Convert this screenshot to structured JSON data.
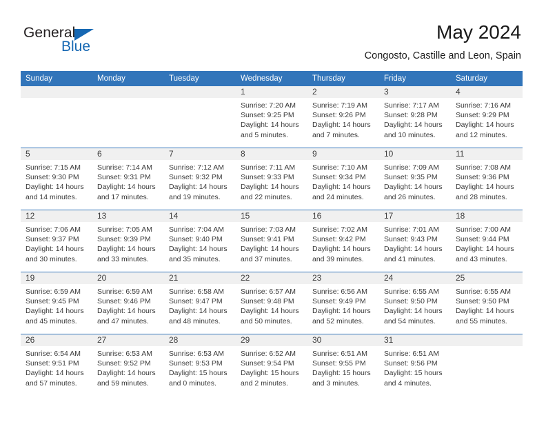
{
  "brand": {
    "name_part1": "General",
    "name_part2": "Blue",
    "accent_color": "#1668b3"
  },
  "header": {
    "month_title": "May 2024",
    "location": "Congosto, Castille and Leon, Spain"
  },
  "calendar": {
    "header_bg": "#3275ba",
    "daynum_bg": "#f0f0f0",
    "weekday_headers": [
      "Sunday",
      "Monday",
      "Tuesday",
      "Wednesday",
      "Thursday",
      "Friday",
      "Saturday"
    ],
    "weeks": [
      [
        {
          "day": "",
          "sunrise": "",
          "sunset": "",
          "daylight_line1": "",
          "daylight_line2": "",
          "empty": true
        },
        {
          "day": "",
          "sunrise": "",
          "sunset": "",
          "daylight_line1": "",
          "daylight_line2": "",
          "empty": true
        },
        {
          "day": "",
          "sunrise": "",
          "sunset": "",
          "daylight_line1": "",
          "daylight_line2": "",
          "empty": true
        },
        {
          "day": "1",
          "sunrise": "Sunrise: 7:20 AM",
          "sunset": "Sunset: 9:25 PM",
          "daylight_line1": "Daylight: 14 hours",
          "daylight_line2": "and 5 minutes.",
          "empty": false
        },
        {
          "day": "2",
          "sunrise": "Sunrise: 7:19 AM",
          "sunset": "Sunset: 9:26 PM",
          "daylight_line1": "Daylight: 14 hours",
          "daylight_line2": "and 7 minutes.",
          "empty": false
        },
        {
          "day": "3",
          "sunrise": "Sunrise: 7:17 AM",
          "sunset": "Sunset: 9:28 PM",
          "daylight_line1": "Daylight: 14 hours",
          "daylight_line2": "and 10 minutes.",
          "empty": false
        },
        {
          "day": "4",
          "sunrise": "Sunrise: 7:16 AM",
          "sunset": "Sunset: 9:29 PM",
          "daylight_line1": "Daylight: 14 hours",
          "daylight_line2": "and 12 minutes.",
          "empty": false
        }
      ],
      [
        {
          "day": "5",
          "sunrise": "Sunrise: 7:15 AM",
          "sunset": "Sunset: 9:30 PM",
          "daylight_line1": "Daylight: 14 hours",
          "daylight_line2": "and 14 minutes.",
          "empty": false
        },
        {
          "day": "6",
          "sunrise": "Sunrise: 7:14 AM",
          "sunset": "Sunset: 9:31 PM",
          "daylight_line1": "Daylight: 14 hours",
          "daylight_line2": "and 17 minutes.",
          "empty": false
        },
        {
          "day": "7",
          "sunrise": "Sunrise: 7:12 AM",
          "sunset": "Sunset: 9:32 PM",
          "daylight_line1": "Daylight: 14 hours",
          "daylight_line2": "and 19 minutes.",
          "empty": false
        },
        {
          "day": "8",
          "sunrise": "Sunrise: 7:11 AM",
          "sunset": "Sunset: 9:33 PM",
          "daylight_line1": "Daylight: 14 hours",
          "daylight_line2": "and 22 minutes.",
          "empty": false
        },
        {
          "day": "9",
          "sunrise": "Sunrise: 7:10 AM",
          "sunset": "Sunset: 9:34 PM",
          "daylight_line1": "Daylight: 14 hours",
          "daylight_line2": "and 24 minutes.",
          "empty": false
        },
        {
          "day": "10",
          "sunrise": "Sunrise: 7:09 AM",
          "sunset": "Sunset: 9:35 PM",
          "daylight_line1": "Daylight: 14 hours",
          "daylight_line2": "and 26 minutes.",
          "empty": false
        },
        {
          "day": "11",
          "sunrise": "Sunrise: 7:08 AM",
          "sunset": "Sunset: 9:36 PM",
          "daylight_line1": "Daylight: 14 hours",
          "daylight_line2": "and 28 minutes.",
          "empty": false
        }
      ],
      [
        {
          "day": "12",
          "sunrise": "Sunrise: 7:06 AM",
          "sunset": "Sunset: 9:37 PM",
          "daylight_line1": "Daylight: 14 hours",
          "daylight_line2": "and 30 minutes.",
          "empty": false
        },
        {
          "day": "13",
          "sunrise": "Sunrise: 7:05 AM",
          "sunset": "Sunset: 9:39 PM",
          "daylight_line1": "Daylight: 14 hours",
          "daylight_line2": "and 33 minutes.",
          "empty": false
        },
        {
          "day": "14",
          "sunrise": "Sunrise: 7:04 AM",
          "sunset": "Sunset: 9:40 PM",
          "daylight_line1": "Daylight: 14 hours",
          "daylight_line2": "and 35 minutes.",
          "empty": false
        },
        {
          "day": "15",
          "sunrise": "Sunrise: 7:03 AM",
          "sunset": "Sunset: 9:41 PM",
          "daylight_line1": "Daylight: 14 hours",
          "daylight_line2": "and 37 minutes.",
          "empty": false
        },
        {
          "day": "16",
          "sunrise": "Sunrise: 7:02 AM",
          "sunset": "Sunset: 9:42 PM",
          "daylight_line1": "Daylight: 14 hours",
          "daylight_line2": "and 39 minutes.",
          "empty": false
        },
        {
          "day": "17",
          "sunrise": "Sunrise: 7:01 AM",
          "sunset": "Sunset: 9:43 PM",
          "daylight_line1": "Daylight: 14 hours",
          "daylight_line2": "and 41 minutes.",
          "empty": false
        },
        {
          "day": "18",
          "sunrise": "Sunrise: 7:00 AM",
          "sunset": "Sunset: 9:44 PM",
          "daylight_line1": "Daylight: 14 hours",
          "daylight_line2": "and 43 minutes.",
          "empty": false
        }
      ],
      [
        {
          "day": "19",
          "sunrise": "Sunrise: 6:59 AM",
          "sunset": "Sunset: 9:45 PM",
          "daylight_line1": "Daylight: 14 hours",
          "daylight_line2": "and 45 minutes.",
          "empty": false
        },
        {
          "day": "20",
          "sunrise": "Sunrise: 6:59 AM",
          "sunset": "Sunset: 9:46 PM",
          "daylight_line1": "Daylight: 14 hours",
          "daylight_line2": "and 47 minutes.",
          "empty": false
        },
        {
          "day": "21",
          "sunrise": "Sunrise: 6:58 AM",
          "sunset": "Sunset: 9:47 PM",
          "daylight_line1": "Daylight: 14 hours",
          "daylight_line2": "and 48 minutes.",
          "empty": false
        },
        {
          "day": "22",
          "sunrise": "Sunrise: 6:57 AM",
          "sunset": "Sunset: 9:48 PM",
          "daylight_line1": "Daylight: 14 hours",
          "daylight_line2": "and 50 minutes.",
          "empty": false
        },
        {
          "day": "23",
          "sunrise": "Sunrise: 6:56 AM",
          "sunset": "Sunset: 9:49 PM",
          "daylight_line1": "Daylight: 14 hours",
          "daylight_line2": "and 52 minutes.",
          "empty": false
        },
        {
          "day": "24",
          "sunrise": "Sunrise: 6:55 AM",
          "sunset": "Sunset: 9:50 PM",
          "daylight_line1": "Daylight: 14 hours",
          "daylight_line2": "and 54 minutes.",
          "empty": false
        },
        {
          "day": "25",
          "sunrise": "Sunrise: 6:55 AM",
          "sunset": "Sunset: 9:50 PM",
          "daylight_line1": "Daylight: 14 hours",
          "daylight_line2": "and 55 minutes.",
          "empty": false
        }
      ],
      [
        {
          "day": "26",
          "sunrise": "Sunrise: 6:54 AM",
          "sunset": "Sunset: 9:51 PM",
          "daylight_line1": "Daylight: 14 hours",
          "daylight_line2": "and 57 minutes.",
          "empty": false
        },
        {
          "day": "27",
          "sunrise": "Sunrise: 6:53 AM",
          "sunset": "Sunset: 9:52 PM",
          "daylight_line1": "Daylight: 14 hours",
          "daylight_line2": "and 59 minutes.",
          "empty": false
        },
        {
          "day": "28",
          "sunrise": "Sunrise: 6:53 AM",
          "sunset": "Sunset: 9:53 PM",
          "daylight_line1": "Daylight: 15 hours",
          "daylight_line2": "and 0 minutes.",
          "empty": false
        },
        {
          "day": "29",
          "sunrise": "Sunrise: 6:52 AM",
          "sunset": "Sunset: 9:54 PM",
          "daylight_line1": "Daylight: 15 hours",
          "daylight_line2": "and 2 minutes.",
          "empty": false
        },
        {
          "day": "30",
          "sunrise": "Sunrise: 6:51 AM",
          "sunset": "Sunset: 9:55 PM",
          "daylight_line1": "Daylight: 15 hours",
          "daylight_line2": "and 3 minutes.",
          "empty": false
        },
        {
          "day": "31",
          "sunrise": "Sunrise: 6:51 AM",
          "sunset": "Sunset: 9:56 PM",
          "daylight_line1": "Daylight: 15 hours",
          "daylight_line2": "and 4 minutes.",
          "empty": false
        },
        {
          "day": "",
          "sunrise": "",
          "sunset": "",
          "daylight_line1": "",
          "daylight_line2": "",
          "empty": true
        }
      ]
    ]
  }
}
